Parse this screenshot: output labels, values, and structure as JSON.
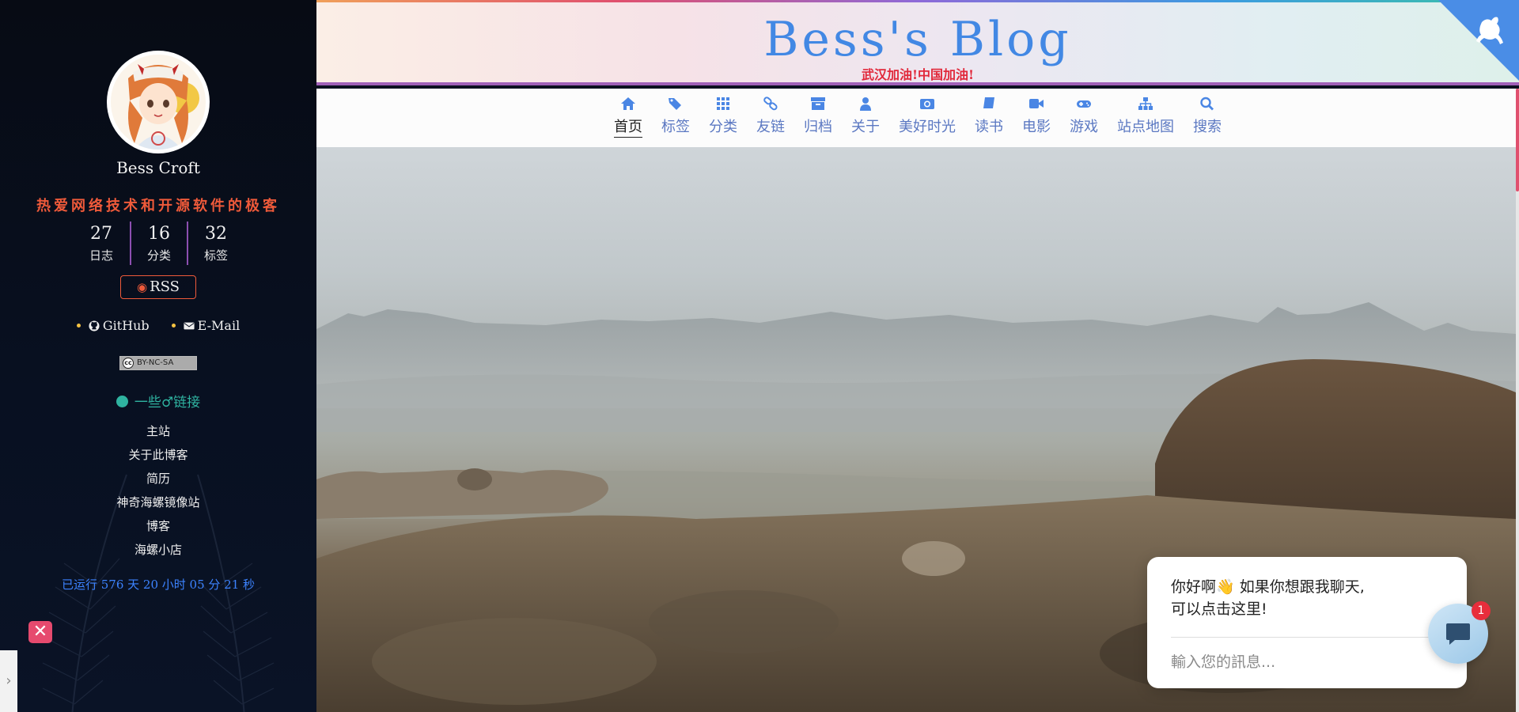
{
  "sidebar": {
    "author": "Bess Croft",
    "motto": "热爱网络技术和开源软件的极客",
    "stats": [
      {
        "num": "27",
        "label": "日志"
      },
      {
        "num": "16",
        "label": "分类"
      },
      {
        "num": "32",
        "label": "标签"
      }
    ],
    "rss_label": "RSS",
    "social": [
      {
        "label": "GitHub",
        "icon": "github-icon"
      },
      {
        "label": "E-Mail",
        "icon": "envelope-icon"
      }
    ],
    "license": "BY-NC-SA",
    "links_title": "一些♂链接",
    "links": [
      "主站",
      "关于此博客",
      "简历",
      "神奇海螺镜像站",
      "博客",
      "海螺小店"
    ],
    "runtime": "已运行 576 天 20 小时 05 分 21 秒",
    "close_glyph": "✕",
    "toggle_glyph": "›"
  },
  "header": {
    "title": "Bess's Blog",
    "subtitle": "武汉加油!中国加油!"
  },
  "nav": [
    {
      "label": "首页",
      "icon": "home-icon",
      "active": true
    },
    {
      "label": "标签",
      "icon": "tags-icon"
    },
    {
      "label": "分类",
      "icon": "grid-icon"
    },
    {
      "label": "友链",
      "icon": "link-icon"
    },
    {
      "label": "归档",
      "icon": "archive-icon"
    },
    {
      "label": "关于",
      "icon": "user-icon"
    },
    {
      "label": "美好时光",
      "icon": "camera-icon"
    },
    {
      "label": "读书",
      "icon": "book-icon"
    },
    {
      "label": "电影",
      "icon": "video-icon"
    },
    {
      "label": "游戏",
      "icon": "gamepad-icon"
    },
    {
      "label": "站点地图",
      "icon": "sitemap-icon"
    },
    {
      "label": "搜索",
      "icon": "search-icon"
    }
  ],
  "chat": {
    "message_line1": "你好啊👋 如果你想跟我聊天,",
    "message_line2": "可以点击这里!",
    "input_placeholder": "輸入您的訊息...",
    "badge": "1"
  },
  "colors": {
    "accent": "#4288e4",
    "motto": "#ef5a3a",
    "runtime": "#3c83ff",
    "links_title": "#2fb3a0",
    "subtitle": "#e1283a"
  }
}
